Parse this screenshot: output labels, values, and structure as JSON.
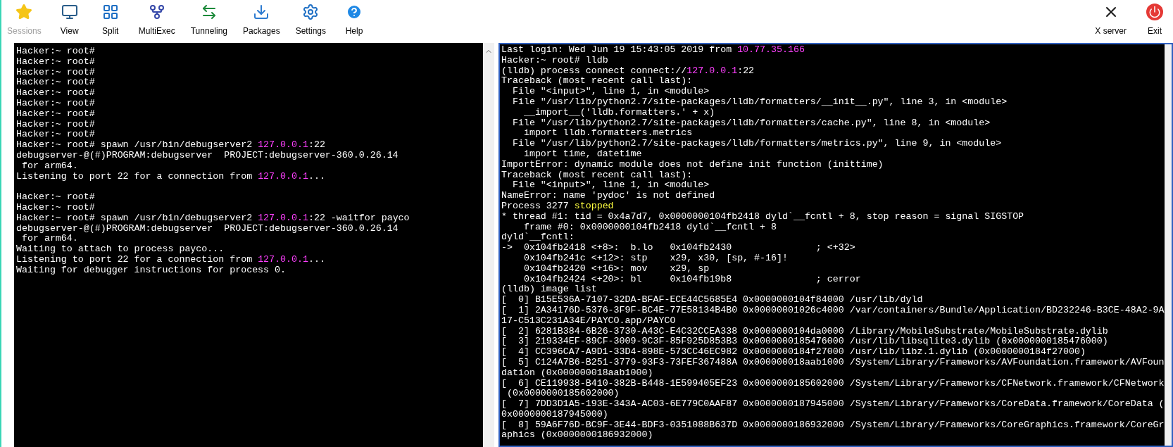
{
  "toolbar": {
    "items": [
      {
        "label": "Sessions",
        "disabled": true
      },
      {
        "label": "View",
        "disabled": false
      },
      {
        "label": "Split",
        "disabled": false
      },
      {
        "label": "MultiExec",
        "disabled": false
      },
      {
        "label": "Tunneling",
        "disabled": false
      },
      {
        "label": "Packages",
        "disabled": false
      },
      {
        "label": "Settings",
        "disabled": false
      },
      {
        "label": "Help",
        "disabled": false
      }
    ],
    "right_items": [
      {
        "label": "X server",
        "disabled": false
      },
      {
        "label": "Exit",
        "disabled": false
      }
    ]
  },
  "left_terminal": {
    "blocks": [
      {
        "lines": [
          [
            {
              "t": "Hacker:~ root#"
            }
          ],
          [
            {
              "t": "Hacker:~ root#"
            }
          ],
          [
            {
              "t": "Hacker:~ root#"
            }
          ],
          [
            {
              "t": "Hacker:~ root#"
            }
          ],
          [
            {
              "t": "Hacker:~ root#"
            }
          ],
          [
            {
              "t": "Hacker:~ root#"
            }
          ],
          [
            {
              "t": "Hacker:~ root#"
            }
          ],
          [
            {
              "t": "Hacker:~ root#"
            }
          ],
          [
            {
              "t": "Hacker:~ root#"
            }
          ],
          [
            {
              "t": "Hacker:~ root# spawn /usr/bin/debugserver2 "
            },
            {
              "t": "127.0.0.1",
              "color": "#ff40ff"
            },
            {
              "t": ":22"
            }
          ],
          [
            {
              "t": "debugserver-@(#)PROGRAM:debugserver  PROJECT:debugserver-360.0.26.14"
            }
          ],
          [
            {
              "t": " for arm64."
            }
          ],
          [
            {
              "t": "Listening to port 22 for a connection from "
            },
            {
              "t": "127.0.0.1",
              "color": "#ff40ff"
            },
            {
              "t": "..."
            }
          ]
        ]
      },
      {
        "lines": [
          [
            {
              "t": "Hacker:~ root#"
            }
          ],
          [
            {
              "t": "Hacker:~ root#"
            }
          ],
          [
            {
              "t": "Hacker:~ root# spawn /usr/bin/debugserver2 "
            },
            {
              "t": "127.0.0.1",
              "color": "#ff40ff"
            },
            {
              "t": ":22 -waitfor payco"
            }
          ],
          [
            {
              "t": "debugserver-@(#)PROGRAM:debugserver  PROJECT:debugserver-360.0.26.14"
            }
          ],
          [
            {
              "t": " for arm64."
            }
          ],
          [
            {
              "t": "Waiting to attach to process payco..."
            }
          ],
          [
            {
              "t": "Listening to port 22 for a connection from "
            },
            {
              "t": "127.0.0.1",
              "color": "#ff40ff"
            },
            {
              "t": "..."
            }
          ],
          [
            {
              "t": "Waiting for debugger instructions for process 0."
            }
          ]
        ]
      }
    ]
  },
  "right_terminal": {
    "lines": [
      [
        {
          "t": "Last login: Wed Jun 19 15:43:05 2019 from "
        },
        {
          "t": "10.77.35.166",
          "color": "#ff40ff"
        }
      ],
      [
        {
          "t": "Hacker:~ root# lldb"
        }
      ],
      [
        {
          "t": "(lldb) process connect connect://"
        },
        {
          "t": "127.0.0.1",
          "color": "#ff40ff"
        },
        {
          "t": ":22"
        }
      ],
      [
        {
          "t": "Traceback (most recent call last):"
        }
      ],
      [
        {
          "t": "  File \"<input>\", line 1, in <module>"
        }
      ],
      [
        {
          "t": "  File \"/usr/lib/python2.7/site-packages/lldb/formatters/__init__.py\", line 3, in <module>"
        }
      ],
      [
        {
          "t": "    __import__('lldb.formatters.' + x)"
        }
      ],
      [
        {
          "t": "  File \"/usr/lib/python2.7/site-packages/lldb/formatters/cache.py\", line 8, in <module>"
        }
      ],
      [
        {
          "t": "    import lldb.formatters.metrics"
        }
      ],
      [
        {
          "t": "  File \"/usr/lib/python2.7/site-packages/lldb/formatters/metrics.py\", line 9, in <module>"
        }
      ],
      [
        {
          "t": "    import time, datetime"
        }
      ],
      [
        {
          "t": "ImportError: dynamic module does not define init function (inittime)"
        }
      ],
      [
        {
          "t": "Traceback (most recent call last):"
        }
      ],
      [
        {
          "t": "  File \"<input>\", line 1, in <module>"
        }
      ],
      [
        {
          "t": "NameError: name 'pydoc' is not defined"
        }
      ],
      [
        {
          "t": "Process 3277 "
        },
        {
          "t": "stopped",
          "color": "#ffff40"
        }
      ],
      [
        {
          "t": "* thread #1: tid = 0x4a7d7, 0x0000000104fb2418 dyld`__fcntl + 8, stop reason = signal SIGSTOP"
        }
      ],
      [
        {
          "t": "    frame #0: 0x0000000104fb2418 dyld`__fcntl + 8"
        }
      ],
      [
        {
          "t": "dyld`__fcntl:"
        }
      ],
      [
        {
          "t": "->  0x104fb2418 <+8>:  b.lo   0x104fb2430               ; <+32>"
        }
      ],
      [
        {
          "t": "    0x104fb241c <+12>: stp    x29, x30, [sp, #-16]!"
        }
      ],
      [
        {
          "t": "    0x104fb2420 <+16>: mov    x29, sp"
        }
      ],
      [
        {
          "t": "    0x104fb2424 <+20>: bl     0x104fb19b8               ; cerror"
        }
      ],
      [
        {
          "t": "(lldb) image list"
        }
      ],
      [
        {
          "t": "[  0] B15E536A-7107-32DA-BFAF-ECE44C5685E4 0x0000000104f84000 /usr/lib/dyld"
        }
      ],
      [
        {
          "t": "[  1] 2A34176D-5376-3F9F-BC4E-77E58134B4B0 0x00000001026c4000 /var/containers/Bundle/Application/BD232246-B3CE-48A2-9A"
        }
      ],
      [
        {
          "t": "17-C513C231A34E/PAYCO.app/PAYCO"
        }
      ],
      [
        {
          "t": "[  2] 6281B384-6B26-3730-A43C-E4C32CCEA338 0x0000000104da0000 /Library/MobileSubstrate/MobileSubstrate.dylib"
        }
      ],
      [
        {
          "t": "[  3] 219334EF-89CF-3009-9C3F-85F925D853B3 0x0000000185476000 /usr/lib/libsqlite3.dylib (0x0000000185476000)"
        }
      ],
      [
        {
          "t": "[  4] CC396CA7-A9D1-33D4-898E-573CC46EC982 0x0000000184f27000 /usr/lib/libz.1.dylib (0x0000000184f27000)"
        }
      ],
      [
        {
          "t": "[  5] C124A7B6-B251-3779-93F3-73FEF367488A 0x000000018aab1000 /System/Library/Frameworks/AVFoundation.framework/AVFoun"
        }
      ],
      [
        {
          "t": "dation (0x000000018aab1000)"
        }
      ],
      [
        {
          "t": "[  6] CE119938-B410-382B-B448-1E599405EF23 0x0000000185602000 /System/Library/Frameworks/CFNetwork.framework/CFNetwork"
        }
      ],
      [
        {
          "t": " (0x0000000185602000)"
        }
      ],
      [
        {
          "t": "[  7] 7DD3D1A5-193E-343A-AC03-6E779C0AAF87 0x0000000187945000 /System/Library/Frameworks/CoreData.framework/CoreData ("
        }
      ],
      [
        {
          "t": "0x0000000187945000)"
        }
      ],
      [
        {
          "t": "[  8] 59A6F76D-BC9F-3E44-BDF3-0351088B637D 0x0000000186932000 /System/Library/Frameworks/CoreGraphics.framework/CoreGr"
        }
      ],
      [
        {
          "t": "aphics (0x0000000186932000)"
        }
      ]
    ]
  }
}
